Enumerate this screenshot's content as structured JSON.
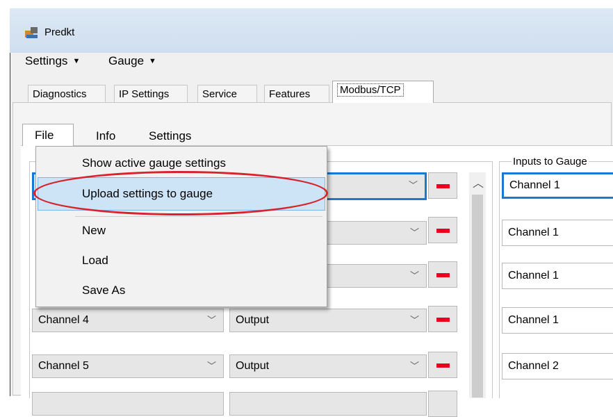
{
  "window": {
    "title": "Predkt"
  },
  "menubar": {
    "settings": "Settings",
    "gauge": "Gauge",
    "caret": "▼"
  },
  "tabs": [
    "Diagnostics",
    "IP Settings",
    "Service",
    "Features",
    "Modbus/TCP"
  ],
  "subtabs": {
    "file": "File",
    "info": "Info",
    "settings": "Settings"
  },
  "file_menu": {
    "items": [
      "Show active gauge settings",
      "Upload settings to gauge",
      "New",
      "Load",
      "Save As"
    ],
    "highlighted": "Upload settings to gauge"
  },
  "rows": [
    {
      "channel": "Channel 4",
      "direction": "Output"
    },
    {
      "channel": "Channel 5",
      "direction": "Output"
    }
  ],
  "inputs_panel": {
    "label": "Inputs to Gauge",
    "values": [
      "Channel 1",
      "Channel 1",
      "Channel 1",
      "Channel 1",
      "Channel 2"
    ]
  },
  "colors": {
    "accent": "#1b78d0",
    "remove_button": "#e8001c",
    "annotation": "#d8222c"
  }
}
